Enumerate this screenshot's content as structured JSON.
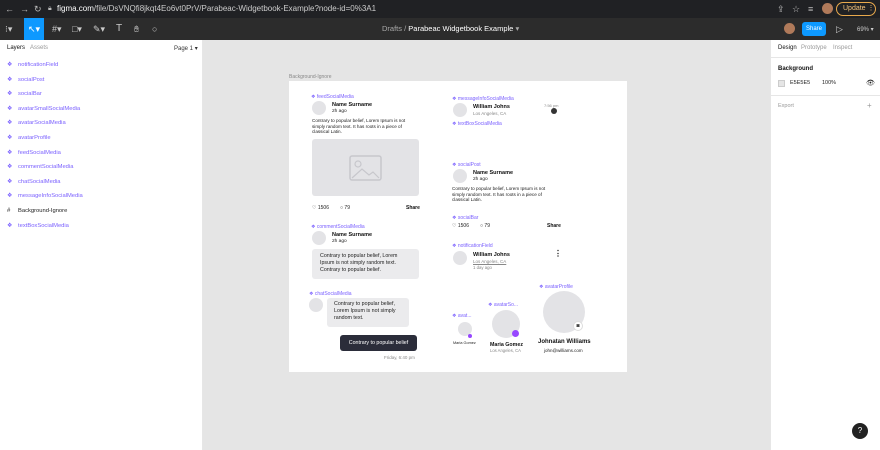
{
  "browser": {
    "url_host": "figma.com",
    "url_path": "/file/DsVNQfi8jkqt4Eo6vt0PrV/Parabeac-Widgetbook-Example?node-id=0%3A1",
    "update_label": "Update"
  },
  "toolbar": {
    "breadcrumb_drafts": "Drafts",
    "separator": "/",
    "file_name": "Parabeac Widgetbook Example",
    "share_label": "Share",
    "zoom": "69%"
  },
  "left_panel": {
    "tab_layers": "Layers",
    "tab_assets": "Assets",
    "page": "Page 1",
    "layers": [
      {
        "label": "notificationField",
        "icon": "component-icon"
      },
      {
        "label": "socialPost",
        "icon": "component-icon"
      },
      {
        "label": "socialBar",
        "icon": "component-icon"
      },
      {
        "label": "avatarSmallSocialMedia",
        "icon": "component-icon"
      },
      {
        "label": "avatarSocialMedia",
        "icon": "component-icon"
      },
      {
        "label": "avatarProfile",
        "icon": "component-icon"
      },
      {
        "label": "feedSocialMedia",
        "icon": "component-icon"
      },
      {
        "label": "commentSocialMedia",
        "icon": "component-icon"
      },
      {
        "label": "chatSocialMedia",
        "icon": "component-icon"
      },
      {
        "label": "messageInfoSocialMedia",
        "icon": "component-icon"
      },
      {
        "label": "Background-Ignore",
        "icon": "frame-icon"
      },
      {
        "label": "textBoxSocialMedia",
        "icon": "component-icon"
      }
    ]
  },
  "right_panel": {
    "tab_design": "Design",
    "tab_prototype": "Prototype",
    "tab_inspect": "Inspect",
    "background_title": "Background",
    "bg_hex": "E5E5E5",
    "bg_opacity": "100%",
    "export_label": "Export"
  },
  "canvas": {
    "frame_label": "Background-Ignore",
    "feed": {
      "component": "feedSocialMedia",
      "name": "Name Surname",
      "time": "2h ago",
      "body": [
        "Contrary to popular belief, Lorem Ipsum is not",
        "simply random text. It has roots in a piece of",
        "classical Latin."
      ],
      "likes": "1506",
      "comments": "79",
      "share": "Share"
    },
    "comment": {
      "component": "commentSocialMedia",
      "name": "Name Surname",
      "time": "2h ago",
      "body": [
        "Contrary to popular belief, Lorem",
        "Ipsum is not simply random text.",
        "Contrary to popular belief."
      ]
    },
    "chat": {
      "component": "chatSocialMedia",
      "in_msg": [
        "Contrary to popular belief,",
        "Lorem Ipsum is not simply",
        "random text."
      ],
      "out_msg": "Contrary to popular belief",
      "time": "Friday, 6:40 pm"
    },
    "message_info": {
      "component": "messageInfoSocialMedia",
      "name": "William Johns",
      "location": "Los Angeles, CA",
      "time": "7:56 pm"
    },
    "textbox": {
      "component": "textBoxSocialMedia"
    },
    "social_post": {
      "component": "socialPost",
      "name": "Name Surname",
      "time": "2h ago",
      "body": [
        "Contrary to popular belief, Lorem Ipsum is not",
        "simply random text. It has roots in a piece of",
        "classical Latin."
      ]
    },
    "social_bar": {
      "component": "socialBar",
      "likes": "1506",
      "comments": "79",
      "share": "Share"
    },
    "notification": {
      "component": "notificationField",
      "name": "William Johns",
      "location": "Los Angeles, CA",
      "time": "1 day ago"
    },
    "avatar_small": {
      "component": "avat...",
      "name": "Maria Gomez"
    },
    "avatar": {
      "component": "avatarSo...",
      "name": "Maria Gomez",
      "location": "Los Angeles, CA"
    },
    "avatar_profile": {
      "component": "avatarProfile",
      "name": "Johnatan Williams",
      "email": "john@williams.com"
    }
  },
  "colors": {
    "accent": "#7b61ff",
    "figma_blue": "#0d99ff",
    "status_purple": "#9747ff"
  }
}
